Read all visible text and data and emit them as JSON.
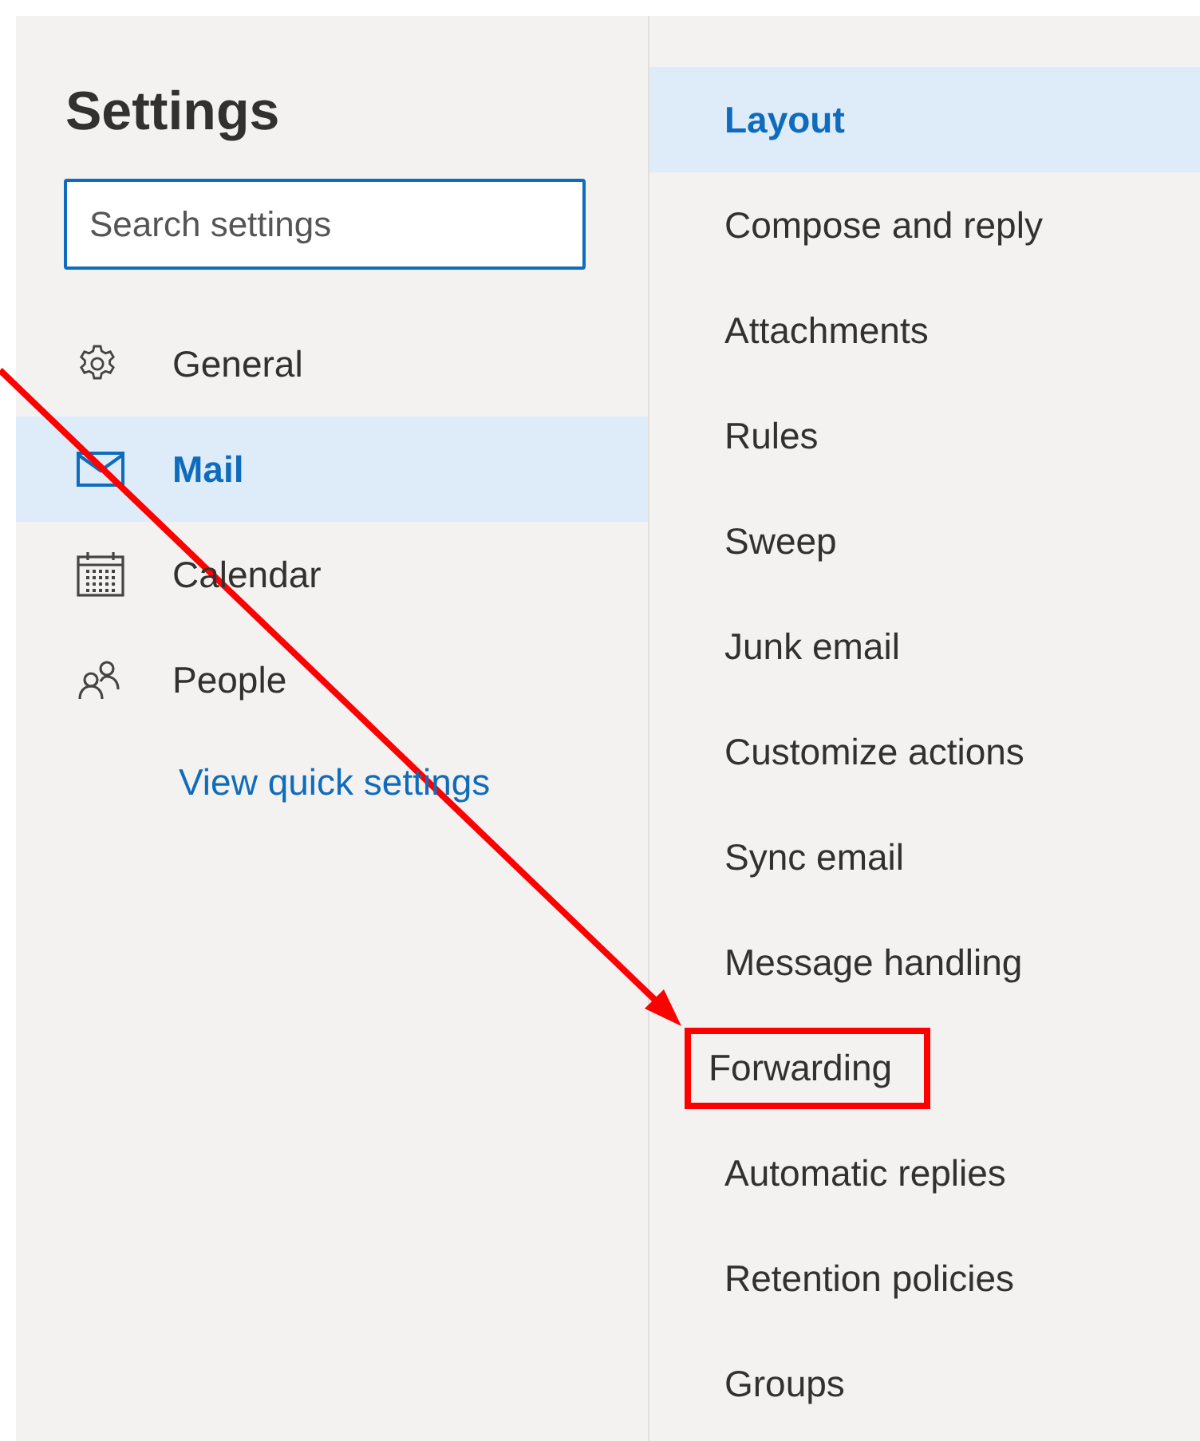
{
  "title": "Settings",
  "search": {
    "placeholder": "Search settings"
  },
  "categories": [
    {
      "label": "General",
      "kind": "gear",
      "selected": false
    },
    {
      "label": "Mail",
      "kind": "mail",
      "selected": true
    },
    {
      "label": "Calendar",
      "kind": "calendar",
      "selected": false
    },
    {
      "label": "People",
      "kind": "people",
      "selected": false
    }
  ],
  "quick_settings_link": "View quick settings",
  "mail_sections": [
    {
      "label": "Layout",
      "selected": true,
      "highlighted": false
    },
    {
      "label": "Compose and reply",
      "selected": false,
      "highlighted": false
    },
    {
      "label": "Attachments",
      "selected": false,
      "highlighted": false
    },
    {
      "label": "Rules",
      "selected": false,
      "highlighted": false
    },
    {
      "label": "Sweep",
      "selected": false,
      "highlighted": false
    },
    {
      "label": "Junk email",
      "selected": false,
      "highlighted": false
    },
    {
      "label": "Customize actions",
      "selected": false,
      "highlighted": false
    },
    {
      "label": "Sync email",
      "selected": false,
      "highlighted": false
    },
    {
      "label": "Message handling",
      "selected": false,
      "highlighted": false
    },
    {
      "label": "Forwarding",
      "selected": false,
      "highlighted": true
    },
    {
      "label": "Automatic replies",
      "selected": false,
      "highlighted": false
    },
    {
      "label": "Retention policies",
      "selected": false,
      "highlighted": false
    },
    {
      "label": "Groups",
      "selected": false,
      "highlighted": false
    }
  ],
  "annotation_arrow": true
}
